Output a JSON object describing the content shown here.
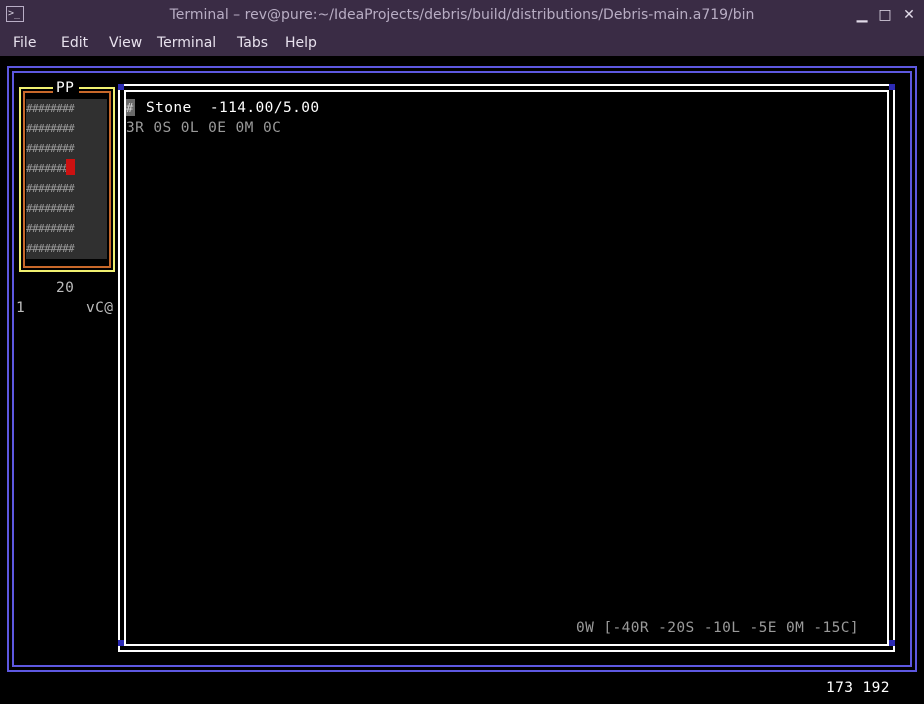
{
  "window": {
    "app_icon": ">_",
    "title": "Terminal – rev@pure:~/IdeaProjects/debris/build/distributions/Debris-main.a719/bin",
    "controls": {
      "minimize": "▁",
      "maximize": "□",
      "close": "✕"
    }
  },
  "menu": [
    "File",
    "Edit",
    "View",
    "Terminal",
    "Tabs",
    "Help"
  ],
  "game": {
    "map": {
      "title": "PP",
      "rows": [
        "########",
        "########",
        "########",
        "########",
        "########",
        "########",
        "########",
        "########"
      ]
    },
    "left_info": {
      "depth": "20",
      "slot": "1",
      "symbols": "vC@"
    },
    "main": {
      "cursor_glyph": "#",
      "item_line": "Stone  -114.00/5.00",
      "resources_line": "3R 0S 0L 0E 0M 0C",
      "bottom_line": "0W [-40R -20S -10L -5E 0M -15C]"
    },
    "status": {
      "coords": "173 192"
    }
  },
  "colors": {
    "chrome": "#3a2c45",
    "outer_frame": "#5d58e0",
    "map_frame_outer": "#f0f070",
    "map_frame_inner": "#c8682a",
    "player": "#cc1111",
    "text": "#bdbdbd",
    "bright_text": "#ffffff"
  }
}
